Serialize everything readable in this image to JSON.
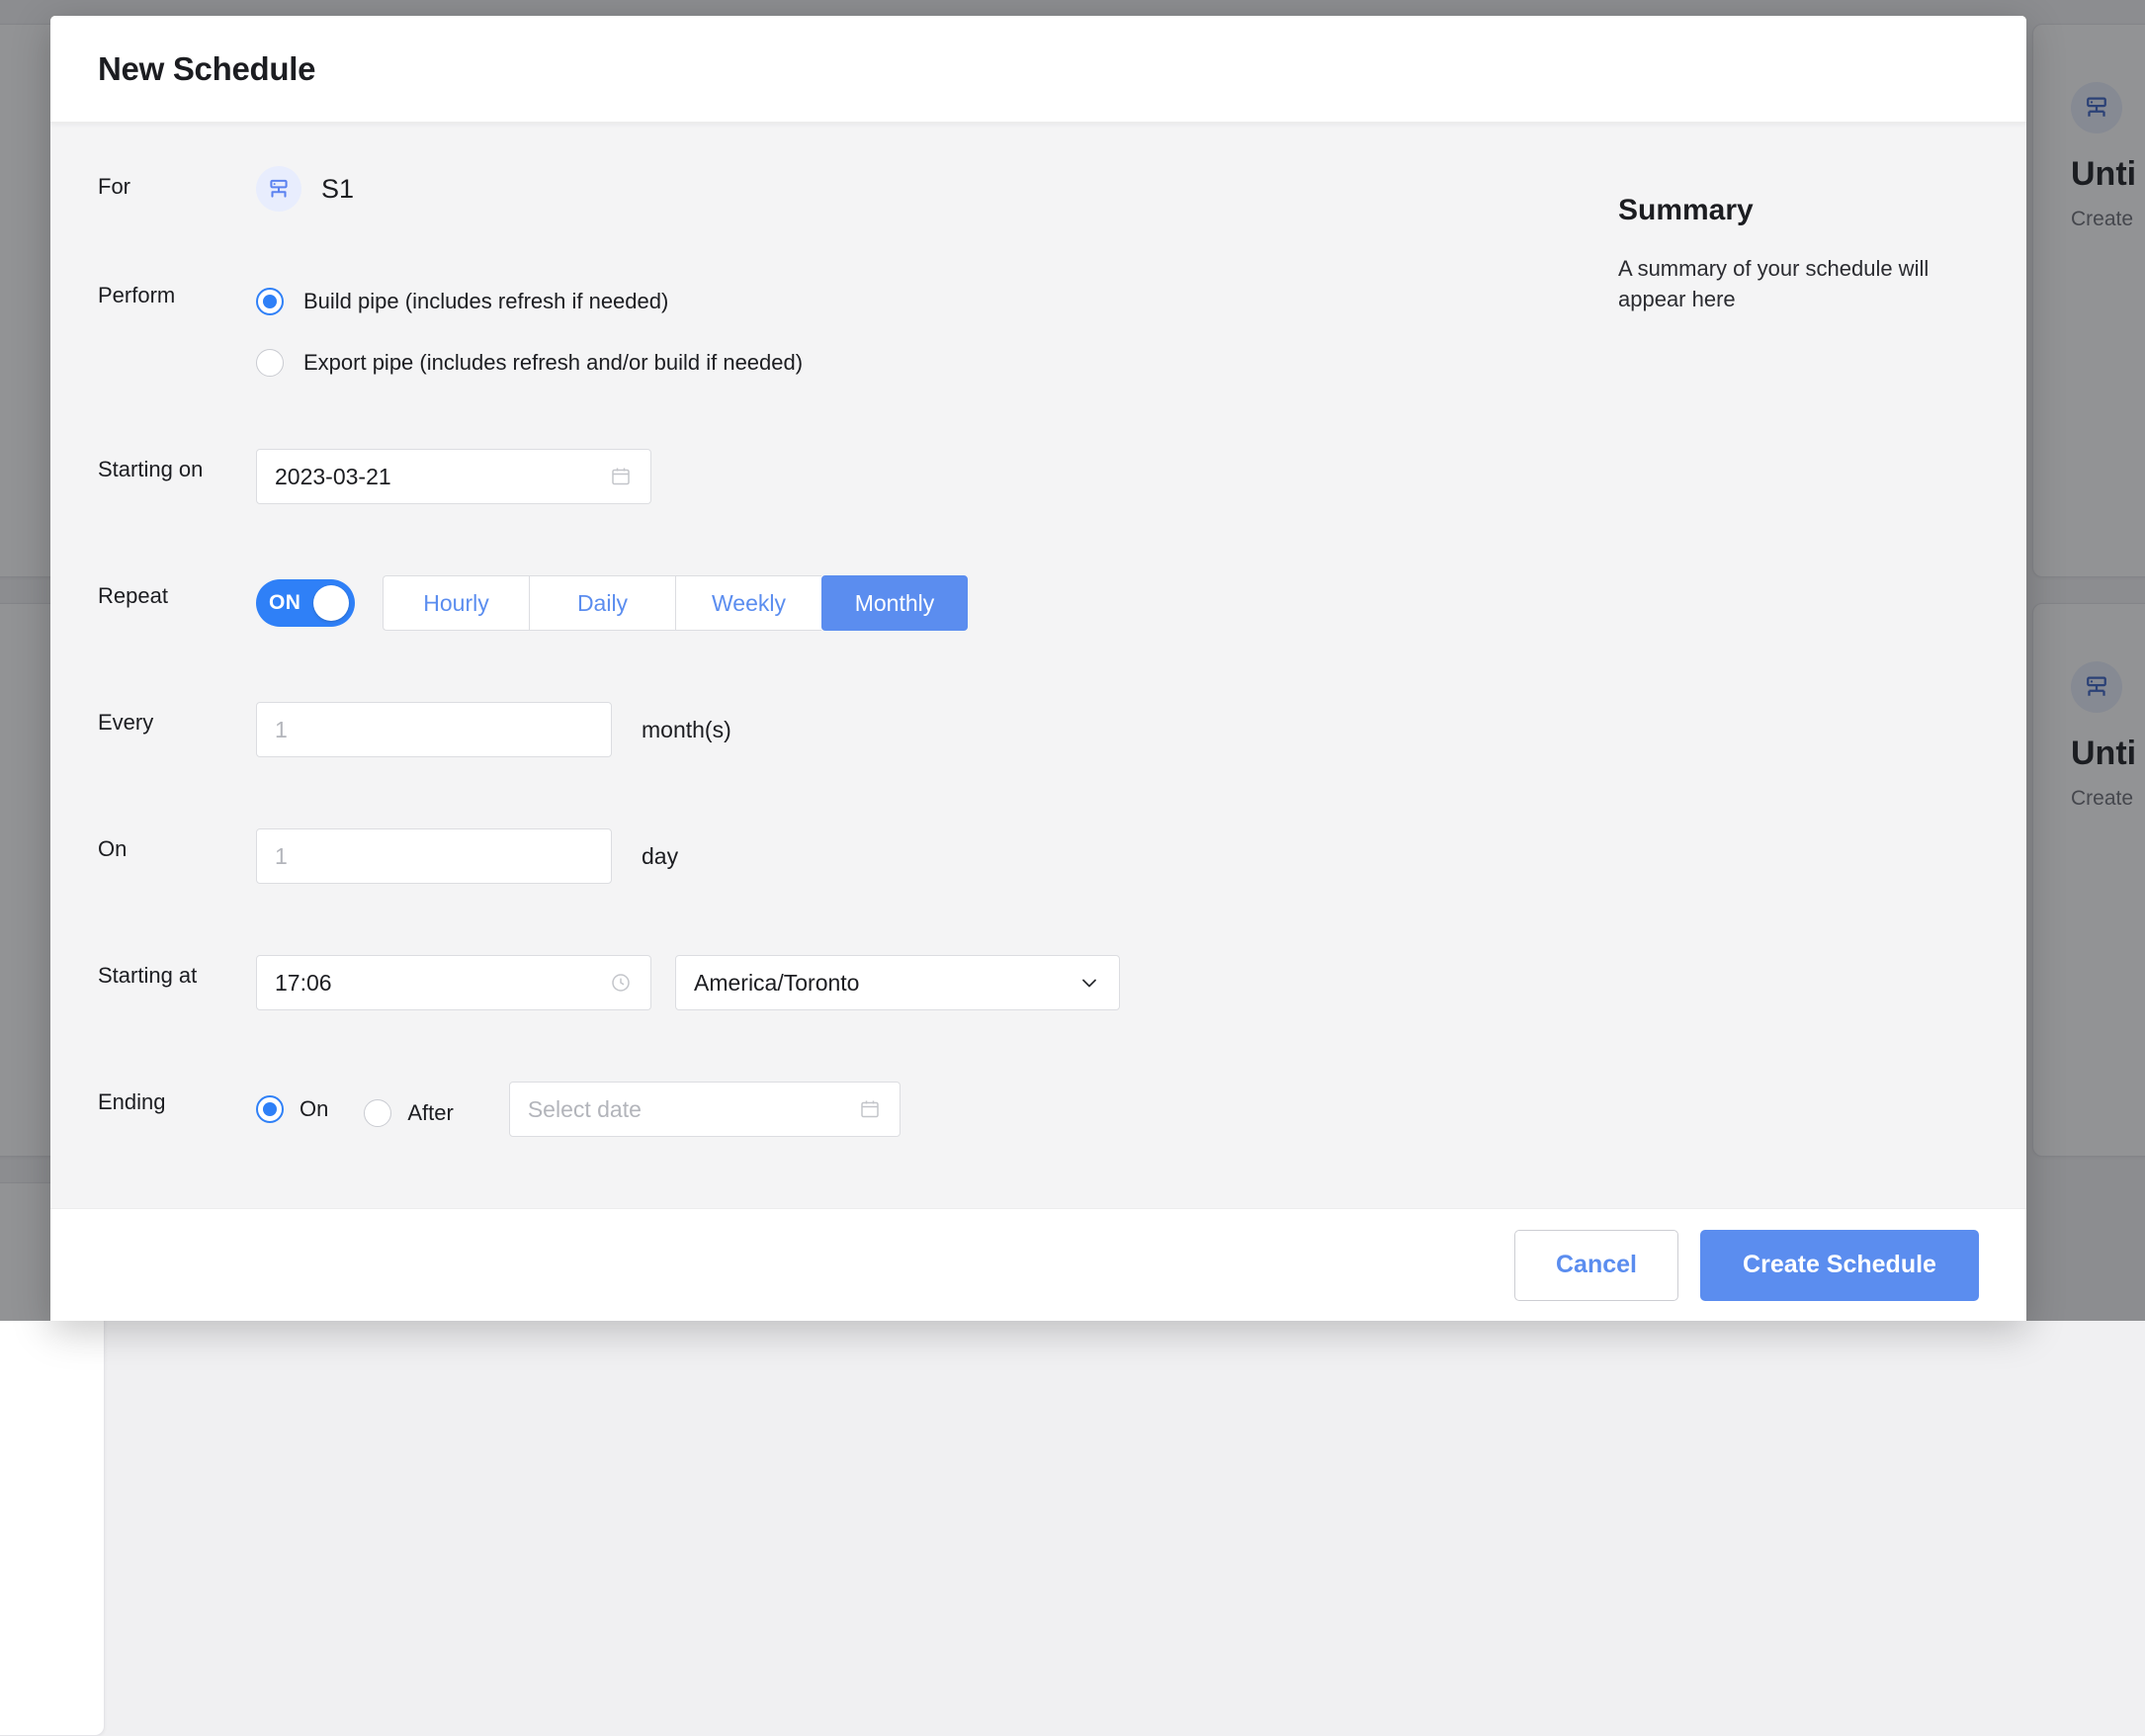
{
  "background": {
    "cards": [
      {
        "title": "Unti",
        "subtitle": "Create"
      },
      {
        "title": "Unti",
        "subtitle": "Create"
      }
    ],
    "icon": "server-pipe-icon"
  },
  "modal": {
    "title": "New Schedule",
    "fields": {
      "for": {
        "label": "For",
        "icon": "server-pipe-icon",
        "value": "S1"
      },
      "perform": {
        "label": "Perform",
        "options": [
          {
            "label": "Build pipe (includes refresh if needed)",
            "selected": true
          },
          {
            "label": "Export pipe (includes refresh and/or build if needed)",
            "selected": false
          }
        ]
      },
      "starting_on": {
        "label": "Starting on",
        "value": "2023-03-21",
        "icon": "calendar-icon"
      },
      "repeat": {
        "label": "Repeat",
        "toggle_state": "ON",
        "toggle_on": true,
        "tabs": [
          {
            "label": "Hourly",
            "active": false
          },
          {
            "label": "Daily",
            "active": false
          },
          {
            "label": "Weekly",
            "active": false
          },
          {
            "label": "Monthly",
            "active": true
          }
        ]
      },
      "every": {
        "label": "Every",
        "placeholder": "1",
        "value": "",
        "suffix": "month(s)"
      },
      "on": {
        "label": "On",
        "placeholder": "1",
        "value": "",
        "suffix": "day"
      },
      "starting_at": {
        "label": "Starting at",
        "time_value": "17:06",
        "time_icon": "clock-icon",
        "timezone_value": "America/Toronto",
        "timezone_icon": "chevron-down-icon"
      },
      "ending": {
        "label": "Ending",
        "options": [
          {
            "label": "On",
            "selected": true
          },
          {
            "label": "After",
            "selected": false
          }
        ],
        "date_placeholder": "Select date",
        "date_icon": "calendar-icon"
      }
    },
    "summary": {
      "title": "Summary",
      "text": "A summary of your schedule will appear here"
    },
    "footer": {
      "cancel_label": "Cancel",
      "create_label": "Create Schedule"
    }
  },
  "colors": {
    "accent_blue": "#5b8def",
    "toggle_blue": "#2f80f7",
    "modal_bg": "#f4f4f5",
    "header_bg": "#ffffff"
  }
}
